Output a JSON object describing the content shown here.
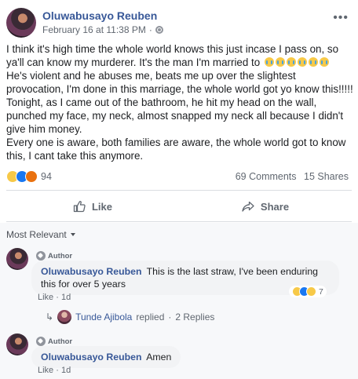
{
  "post": {
    "author": "Oluwabusayo Reuben",
    "timestamp": "February 16 at 11:38 PM",
    "more_label": "•••",
    "text_lines": [
      "I think it's high time the whole world knows this just incase I pass on, so ya'll can know my murderer. It's the man I'm married to",
      "He's violent and he abuses me, beats me up over the slightest provocation, I'm done in this marriage, the whole world got yo know this!!!!!",
      "Tonight, as I came out of the bathroom, he hit my head on the wall, punched my face, my neck, almost snapped my neck all because I didn't give him money.",
      "Every one is aware, both families are aware, the whole world got to know this, I cant take this anymore."
    ],
    "reaction_count": "94",
    "comments_count": "69 Comments",
    "shares_count": "15 Shares",
    "like_label": "Like",
    "share_label": "Share"
  },
  "comments": {
    "sort_label": "Most Relevant",
    "items": [
      {
        "badge": "Author",
        "name": "Oluwabusayo Reuben",
        "text": "This is the last straw, I've been enduring this for over 5 years",
        "like_label": "Like",
        "age": "1d",
        "reaction_count": "7",
        "replier": "Tunde Ajibola",
        "replied_text": "replied",
        "reply_count": "2 Replies"
      },
      {
        "badge": "Author",
        "name": "Oluwabusayo Reuben",
        "text": "Amen",
        "like_label": "Like",
        "age": "1d"
      }
    ]
  },
  "colors": {
    "link": "#385898",
    "meta": "#606770",
    "bubble": "#f2f3f5"
  }
}
